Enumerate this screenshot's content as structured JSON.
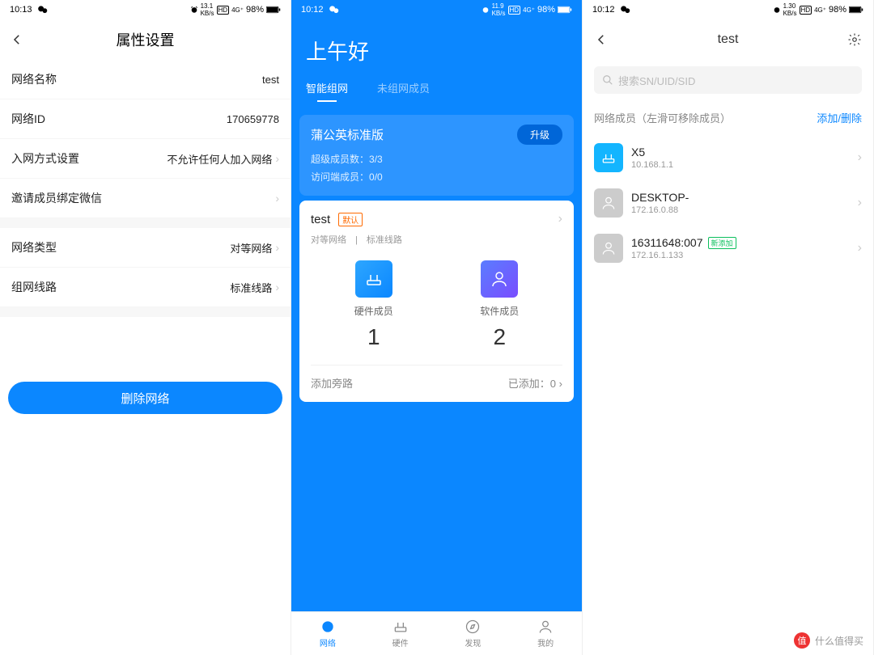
{
  "status": {
    "p1_time": "10:13",
    "p2_time": "10:12",
    "p3_time": "10:12",
    "battery": "98%"
  },
  "p1": {
    "title": "属性设置",
    "rows": [
      {
        "label": "网络名称",
        "value": "test"
      },
      {
        "label": "网络ID",
        "value": "170659778"
      },
      {
        "label": "入网方式设置",
        "value": "不允许任何人加入网络"
      },
      {
        "label": "邀请成员绑定微信",
        "value": ""
      }
    ],
    "rows2": [
      {
        "label": "网络类型",
        "value": "对等网络"
      },
      {
        "label": "组网线路",
        "value": "标准线路"
      }
    ],
    "delete": "删除网络"
  },
  "p2": {
    "greeting": "上午好",
    "tabs": {
      "smart": "智能组网",
      "not_grouped": "未组网成员"
    },
    "plan": {
      "name": "蒲公英标准版",
      "upgrade": "升级",
      "super_label": "超级成员数：",
      "super_val": "3/3",
      "client_label": "访问端成员：",
      "client_val": "0/0"
    },
    "network": {
      "name": "test",
      "tag": "默认",
      "sub": "对等网络　|　标准线路",
      "hw_label": "硬件成员",
      "hw_count": "1",
      "sw_label": "软件成员",
      "sw_count": "2",
      "bypass_label": "添加旁路",
      "bypass_val": "已添加：0"
    },
    "nav": {
      "network": "网络",
      "hardware": "硬件",
      "discover": "发现",
      "mine": "我的"
    }
  },
  "p3": {
    "title": "test",
    "search_placeholder": "搜索SN/UID/SID",
    "section_label": "网络成员（左滑可移除成员）",
    "section_action": "添加/删除",
    "items": [
      {
        "name": "X5",
        "ip": "10.168.1.1",
        "type": "router",
        "tag": ""
      },
      {
        "name": "DESKTOP-",
        "ip": "172.16.0.88",
        "type": "pc",
        "tag": ""
      },
      {
        "name": "16311648:007",
        "ip": "172.16.1.133",
        "type": "pc",
        "tag": "新添加"
      }
    ]
  },
  "wm": "什么值得买"
}
